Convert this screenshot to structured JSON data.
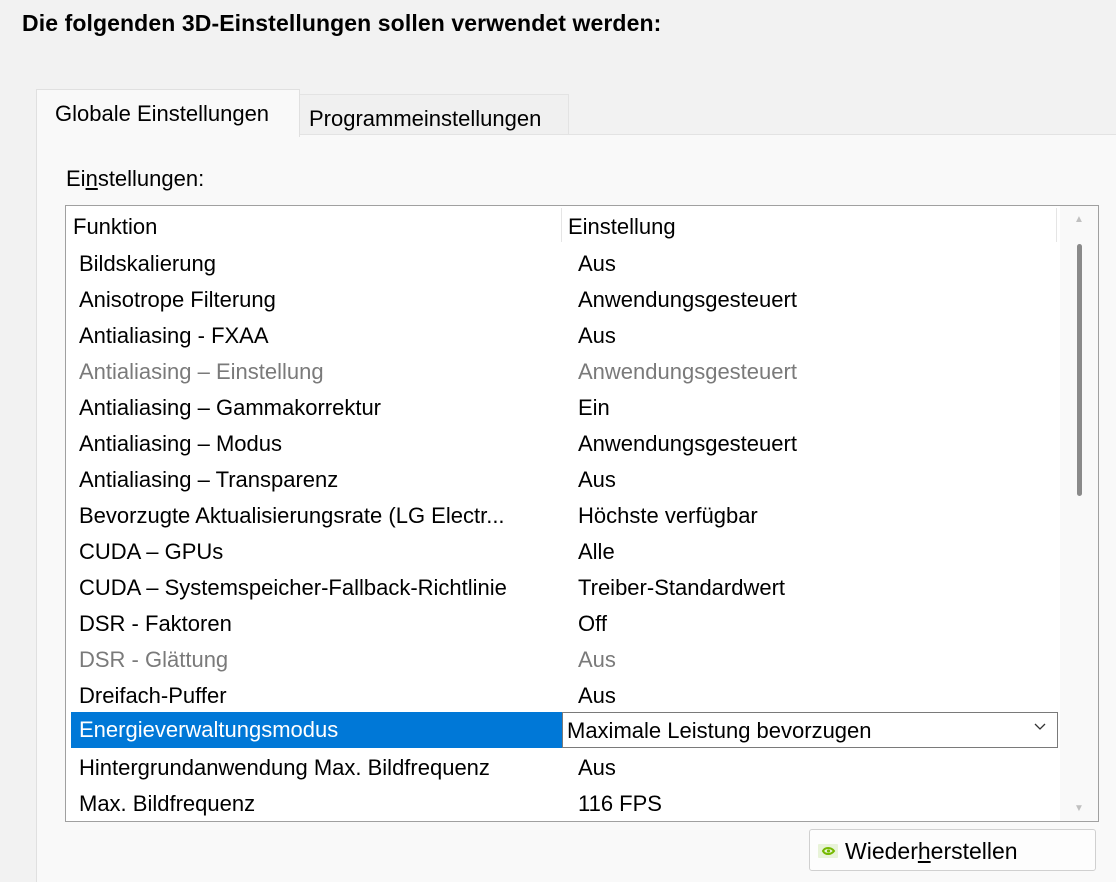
{
  "heading": "Die folgenden 3D-Einstellungen sollen verwendet werden:",
  "tabs": [
    {
      "label": "Globale Einstellungen",
      "active": true
    },
    {
      "label": "Programmeinstellungen",
      "active": false
    }
  ],
  "settings_label": {
    "before": "Ei",
    "mnemonic": "n",
    "after": "stellungen:"
  },
  "table": {
    "columns": [
      "Funktion",
      "Einstellung"
    ],
    "rows": [
      {
        "function": "Bildskalierung",
        "value": "Aus",
        "disabled": false
      },
      {
        "function": "Anisotrope Filterung",
        "value": "Anwendungsgesteuert",
        "disabled": false
      },
      {
        "function": "Antialiasing - FXAA",
        "value": "Aus",
        "disabled": false
      },
      {
        "function": "Antialiasing – Einstellung",
        "value": "Anwendungsgesteuert",
        "disabled": true
      },
      {
        "function": "Antialiasing – Gammakorrektur",
        "value": "Ein",
        "disabled": false
      },
      {
        "function": "Antialiasing – Modus",
        "value": "Anwendungsgesteuert",
        "disabled": false
      },
      {
        "function": "Antialiasing – Transparenz",
        "value": "Aus",
        "disabled": false
      },
      {
        "function": "Bevorzugte Aktualisierungsrate (LG Electr...",
        "value": "Höchste verfügbar",
        "disabled": false
      },
      {
        "function": "CUDA – GPUs",
        "value": "Alle",
        "disabled": false
      },
      {
        "function": "CUDA – Systemspeicher-Fallback-Richtlinie",
        "value": "Treiber-Standardwert",
        "disabled": false
      },
      {
        "function": "DSR - Faktoren",
        "value": "Off",
        "disabled": false
      },
      {
        "function": "DSR - Glättung",
        "value": "Aus",
        "disabled": true
      },
      {
        "function": "Dreifach-Puffer",
        "value": "Aus",
        "disabled": false
      },
      {
        "function": "Energieverwaltungsmodus",
        "value": "Maximale Leistung bevorzugen",
        "disabled": false,
        "selected": true
      },
      {
        "function": "Hintergrundanwendung Max. Bildfrequenz",
        "value": "Aus",
        "disabled": false
      },
      {
        "function": "Max. Bildfrequenz",
        "value": "116 FPS",
        "disabled": false
      }
    ]
  },
  "restore_button": {
    "before": "Wieder",
    "mnemonic": "h",
    "after": "erstellen",
    "icon": "nvidia-icon"
  },
  "colors": {
    "selection": "#0078d7",
    "disabled_text": "#7a7a7a"
  }
}
